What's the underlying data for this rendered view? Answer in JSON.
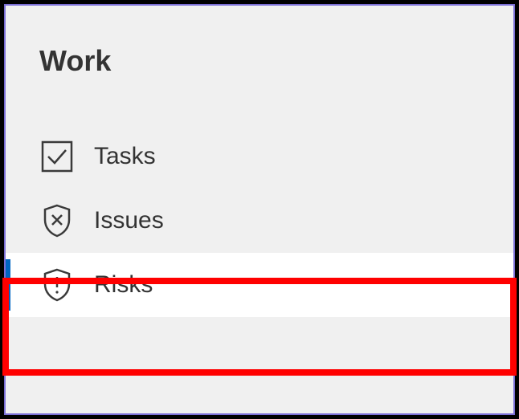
{
  "section": {
    "title": "Work"
  },
  "nav": {
    "items": [
      {
        "label": "Tasks",
        "icon": "checkbox-checked-icon",
        "selected": false
      },
      {
        "label": "Issues",
        "icon": "shield-x-icon",
        "selected": false
      },
      {
        "label": "Risks",
        "icon": "shield-exclamation-icon",
        "selected": true
      }
    ]
  },
  "annotation": {
    "highlight_target": "nav-item-risks"
  }
}
